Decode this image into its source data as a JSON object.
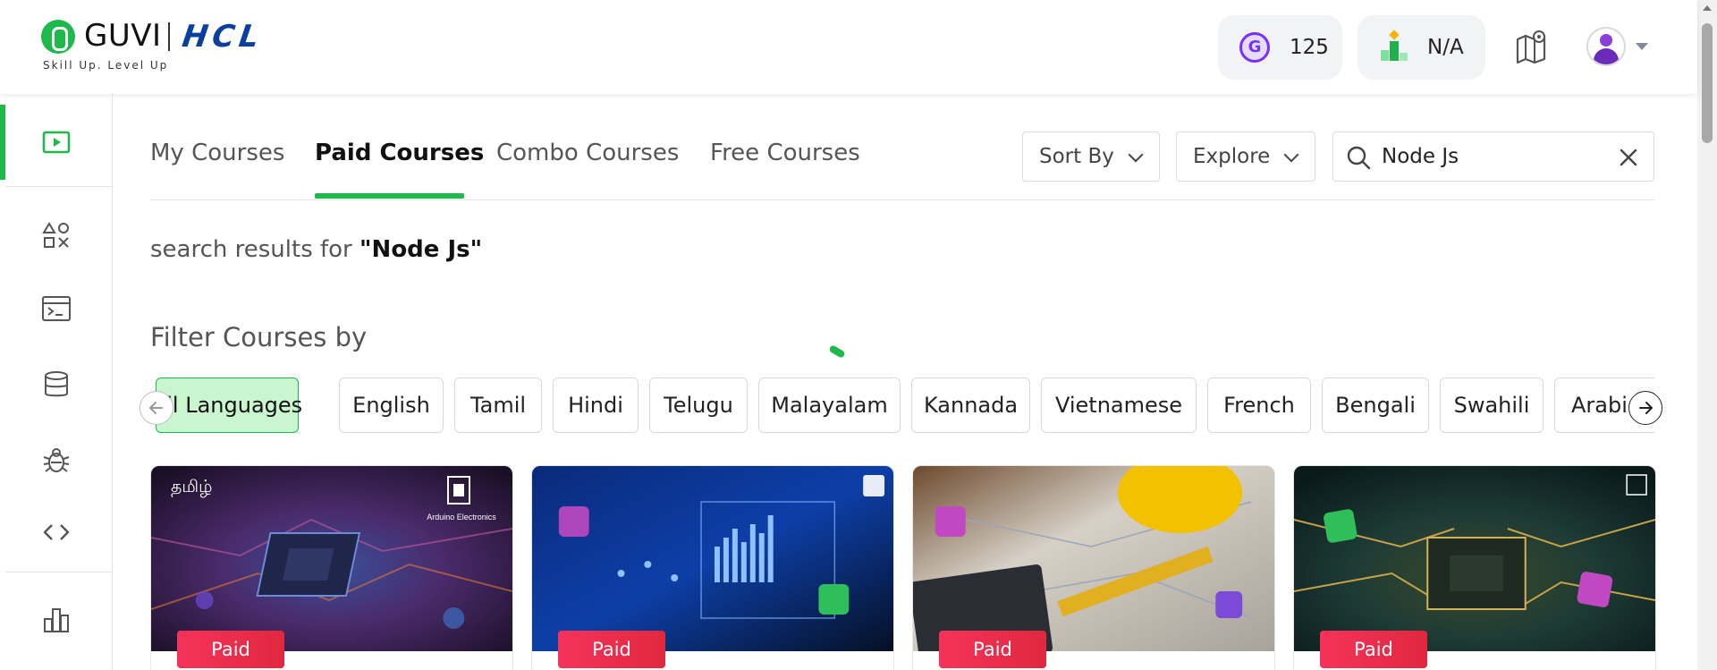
{
  "header": {
    "logo_text": "GUVI",
    "logo_partner": "HCL",
    "logo_tagline": "Skill Up. Level Up",
    "gems_count": "125",
    "rank": "N/A"
  },
  "sidebar": {
    "items": [
      {
        "icon": "play-icon",
        "active": true
      },
      {
        "icon": "shapes-icon",
        "active": false
      },
      {
        "icon": "terminal-icon",
        "active": false
      },
      {
        "icon": "database-icon",
        "active": false
      },
      {
        "icon": "bug-icon",
        "active": false
      },
      {
        "icon": "code-icon",
        "active": false
      },
      {
        "icon": "chart-icon",
        "active": false
      }
    ]
  },
  "tabs": [
    {
      "label": "My Courses"
    },
    {
      "label": "Paid Courses"
    },
    {
      "label": "Combo Courses"
    },
    {
      "label": "Free Courses"
    }
  ],
  "controls": {
    "sort_label": "Sort By",
    "explore_label": "Explore",
    "search_value": "Node Js"
  },
  "results": {
    "prefix": "search results for",
    "query": "\"Node Js\""
  },
  "filter": {
    "title": "Filter Courses by",
    "languages": [
      "All Languages",
      "English",
      "Tamil",
      "Hindi",
      "Telugu",
      "Malayalam",
      "Kannada",
      "Vietnamese",
      "French",
      "Bengali",
      "Swahili",
      "Arabic"
    ],
    "selected": "All Languages"
  },
  "cards": [
    {
      "badge": "Paid",
      "lang": "தமிழ்",
      "tag": "Arduino Electronics"
    },
    {
      "badge": "Paid"
    },
    {
      "badge": "Paid"
    },
    {
      "badge": "Paid"
    }
  ],
  "colors": {
    "accent": "#1fb84b",
    "brand_blue": "#0b3f9e",
    "paid_badge": "#ef2f52"
  }
}
